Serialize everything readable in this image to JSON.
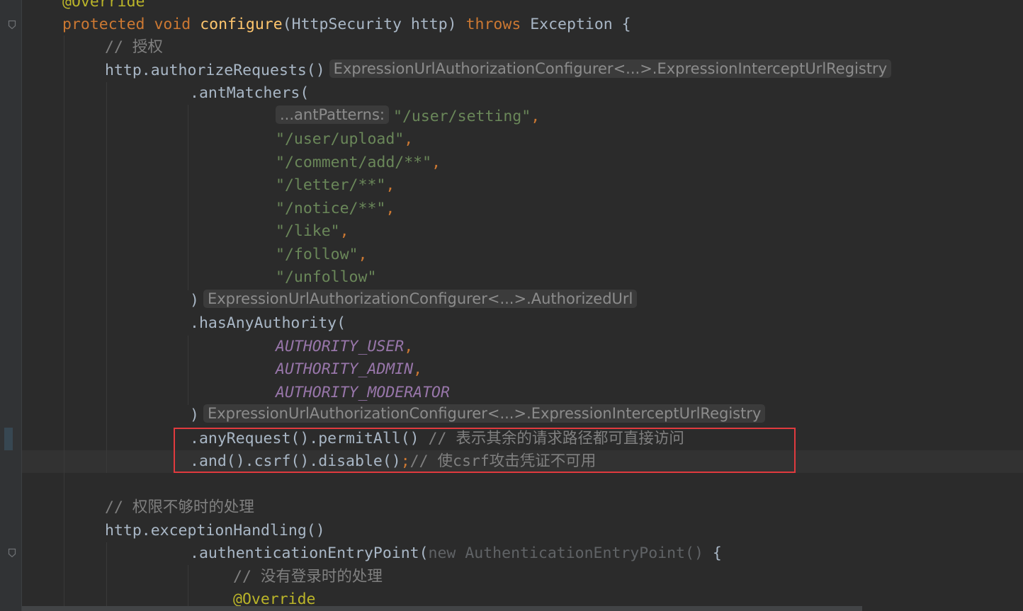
{
  "colors": {
    "background": "#2b2b2b",
    "keyword": "#cc7832",
    "method": "#ffc66d",
    "annotation": "#bbb529",
    "string": "#6a8759",
    "comment": "#808080",
    "constant": "#9876aa",
    "text": "#a9b7c6",
    "highlight_border": "#e03a3e"
  },
  "code": {
    "l01": {
      "annotation": "@Override"
    },
    "l02": {
      "kw_protected": "protected",
      "kw_void": "void",
      "method_name": "configure",
      "params": "(HttpSecurity http)",
      "kw_throws": "throws",
      "exception": "Exception {"
    },
    "l03": {
      "comment": "// 授权"
    },
    "l04": {
      "code": "http.authorizeRequests()",
      "hint": "ExpressionUrlAuthorizationConfigurer<...>.ExpressionInterceptUrlRegistry"
    },
    "l05": {
      "code": ".antMatchers("
    },
    "l06": {
      "param_hint": "...antPatterns:",
      "string": "\"/user/setting\"",
      "comma": ","
    },
    "l07": {
      "string": "\"/user/upload\"",
      "comma": ","
    },
    "l08": {
      "string": "\"/comment/add/**\"",
      "comma": ","
    },
    "l09": {
      "string": "\"/letter/**\"",
      "comma": ","
    },
    "l10": {
      "string": "\"/notice/**\"",
      "comma": ","
    },
    "l11": {
      "string": "\"/like\"",
      "comma": ","
    },
    "l12": {
      "string": "\"/follow\"",
      "comma": ","
    },
    "l13": {
      "string": "\"/unfollow\""
    },
    "l14": {
      "code": ")",
      "hint": "ExpressionUrlAuthorizationConfigurer<...>.AuthorizedUrl"
    },
    "l15": {
      "code": ".hasAnyAuthority("
    },
    "l16": {
      "constant": "AUTHORITY_USER",
      "comma": ","
    },
    "l17": {
      "constant": "AUTHORITY_ADMIN",
      "comma": ","
    },
    "l18": {
      "constant": "AUTHORITY_MODERATOR"
    },
    "l19": {
      "code": ")",
      "hint": "ExpressionUrlAuthorizationConfigurer<...>.ExpressionInterceptUrlRegistry"
    },
    "l20": {
      "code": ".anyRequest().permitAll()",
      "comment": " // 表示其余的请求路径都可直接访问"
    },
    "l21": {
      "code": ".and().csrf().disable()",
      "semicolon": ";",
      "comment": "// 使csrf攻击凭证不可用"
    },
    "l23": {
      "comment": "// 权限不够时的处理"
    },
    "l24": {
      "code": "http.exceptionHandling()"
    },
    "l25": {
      "code": ".authenticationEntryPoint(",
      "kw_new": "new",
      "class_name": "AuthenticationEntryPoint()",
      "brace": " {"
    },
    "l26": {
      "comment": "// 没有登录时的处理"
    },
    "l27": {
      "annotation": "@Override"
    }
  }
}
